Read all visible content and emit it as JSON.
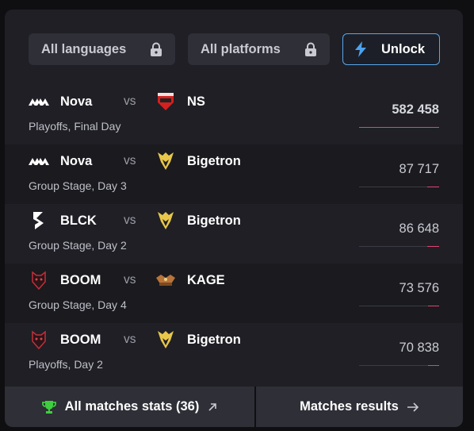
{
  "filters": {
    "languages_label": "All languages",
    "platforms_label": "All platforms",
    "unlock_label": "Unlock"
  },
  "vs_label": "vs",
  "matches": [
    {
      "team1": "Nova",
      "team2": "NS",
      "stage": "Playoffs, Final Day",
      "viewers": "582 458",
      "viewers_value": 582458,
      "team1_logo": "nova-logo",
      "team2_logo": "ns-logo"
    },
    {
      "team1": "Nova",
      "team2": "Bigetron",
      "stage": "Group Stage, Day 3",
      "viewers": "87 717",
      "viewers_value": 87717,
      "team1_logo": "nova-logo",
      "team2_logo": "bigetron-logo"
    },
    {
      "team1": "BLCK",
      "team2": "Bigetron",
      "stage": "Group Stage, Day 2",
      "viewers": "86 648",
      "viewers_value": 86648,
      "team1_logo": "blck-logo",
      "team2_logo": "bigetron-logo"
    },
    {
      "team1": "BOOM",
      "team2": "KAGE",
      "stage": "Group Stage, Day 4",
      "viewers": "73 576",
      "viewers_value": 73576,
      "team1_logo": "boom-logo",
      "team2_logo": "kage-logo"
    },
    {
      "team1": "BOOM",
      "team2": "Bigetron",
      "stage": "Playoffs, Day 2",
      "viewers": "70 838",
      "viewers_value": 70838,
      "team1_logo": "boom-logo",
      "team2_logo": "bigetron-logo"
    }
  ],
  "footer": {
    "all_stats_label": "All matches stats (36)",
    "results_label": "Matches results"
  },
  "colors": {
    "accent_bar": "#e0456f",
    "unlock_border": "#5aa6e8",
    "trophy": "#3ecf3e"
  }
}
